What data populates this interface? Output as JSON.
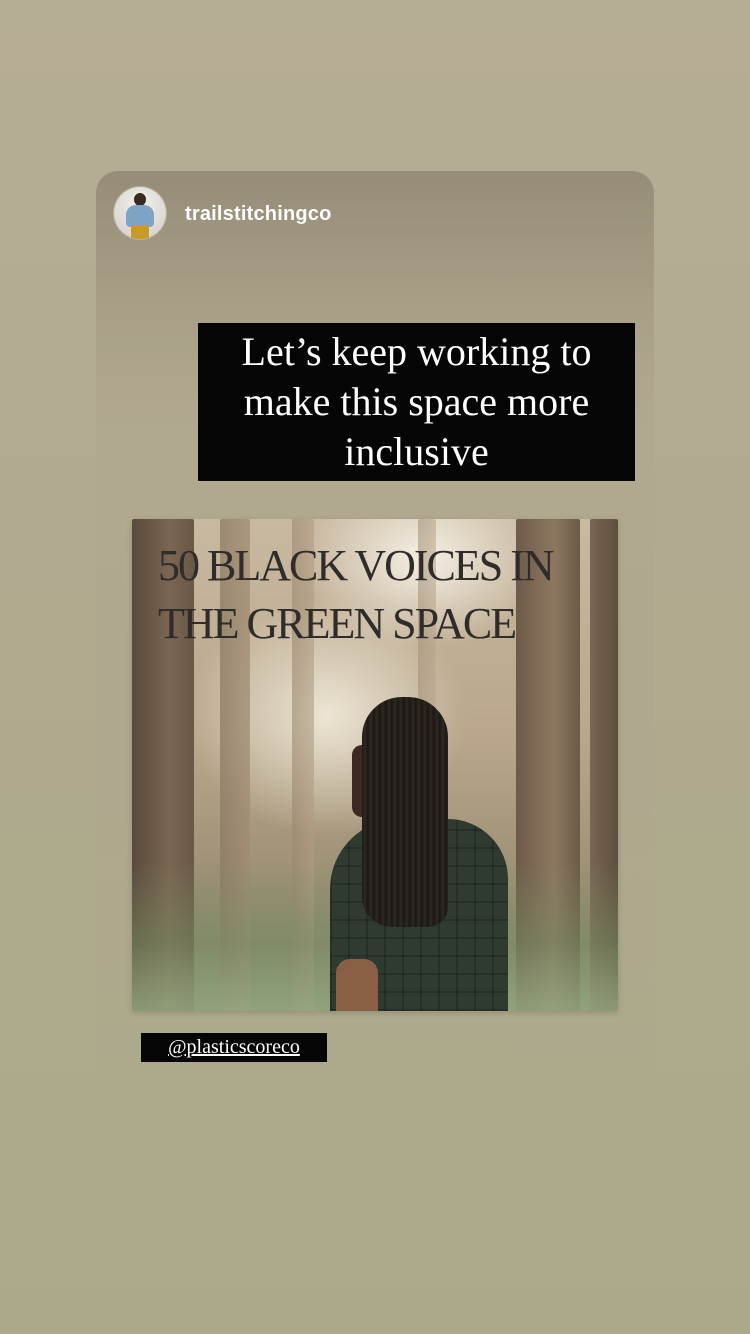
{
  "story": {
    "username": "trailstitchingco",
    "caption": "Let’s keep working to make this space more inclusive",
    "mention": "@plasticscoreco"
  },
  "shared_post": {
    "title": "50 BLACK VOICES IN THE GREEN SPACE"
  },
  "colors": {
    "background": "#b3aa8f",
    "caption_bg": "#050505",
    "caption_text": "#ffffff"
  }
}
